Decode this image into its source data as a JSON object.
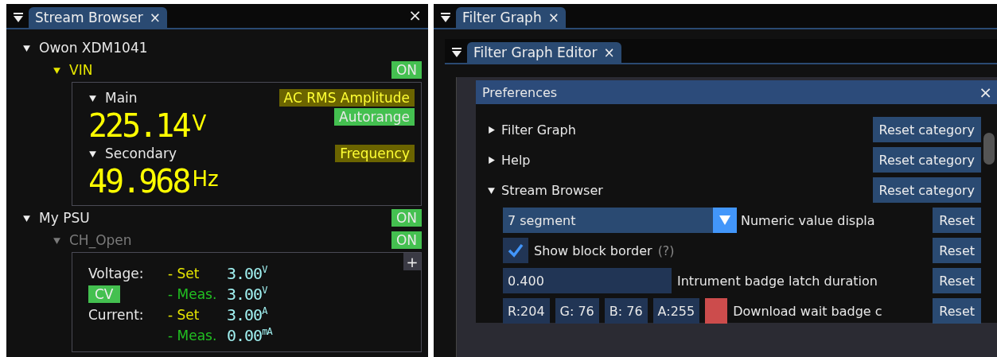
{
  "stream_browser": {
    "tab": "Stream Browser",
    "close": "×",
    "instruments": [
      {
        "name": "Owon XDM1041",
        "expanded": true,
        "channels": [
          {
            "name": "VIN",
            "kind": "meter",
            "color": "#e6e600",
            "expanded": true,
            "badge": "ON",
            "readings": [
              {
                "name": "Main",
                "expanded": true,
                "mode": "AC RMS Amplitude",
                "range": "Autorange",
                "value": "225.14",
                "unit": "V"
              },
              {
                "name": "Secondary",
                "expanded": true,
                "mode": "Frequency",
                "value": "49.968",
                "unit": "Hz"
              }
            ]
          }
        ]
      },
      {
        "name": "My PSU",
        "expanded": true,
        "badge": "ON",
        "channels": [
          {
            "name": "CH_Open",
            "kind": "psu",
            "color": "#7a7a7a",
            "expanded": true,
            "badge": "ON",
            "add": "+",
            "rows": [
              {
                "label": "Voltage:",
                "kind": "set",
                "part": "- Set",
                "value": "3.00",
                "unit": "V"
              },
              {
                "status": "CV",
                "kind": "meas",
                "part": "- Meas.",
                "value": "3.00",
                "unit": "V"
              },
              {
                "label": "Current:",
                "kind": "set",
                "part": "- Set",
                "value": "3.00",
                "unit": "A"
              },
              {
                "kind": "meas",
                "part": "- Meas.",
                "value": "0.00",
                "unit": "mA"
              }
            ]
          }
        ]
      }
    ]
  },
  "filter_graph": {
    "tab": "Filter Graph",
    "editor_tab": "Filter Graph Editor",
    "preferences": {
      "title": "Preferences",
      "close": "×",
      "categories": [
        {
          "name": "Filter Graph",
          "expanded": false,
          "button": "Reset category"
        },
        {
          "name": "Help",
          "expanded": false,
          "button": "Reset category"
        },
        {
          "name": "Stream Browser",
          "expanded": true,
          "button": "Reset category",
          "settings": [
            {
              "kind": "dropdown",
              "value": "7 segment",
              "label": "Numeric value displa",
              "reset": "Reset"
            },
            {
              "kind": "checkbox",
              "checked": true,
              "caption": "Show block border",
              "hint": "(?)",
              "reset": "Reset"
            },
            {
              "kind": "number",
              "value": "0.400",
              "label": "Intrument badge latch duration",
              "reset": "Reset"
            },
            {
              "kind": "color",
              "components": [
                "R:204",
                "G: 76",
                "B: 76",
                "A:255"
              ],
              "color": "#cc4c4c",
              "label": "Download wait badge c",
              "reset": "Reset"
            }
          ]
        }
      ]
    }
  }
}
